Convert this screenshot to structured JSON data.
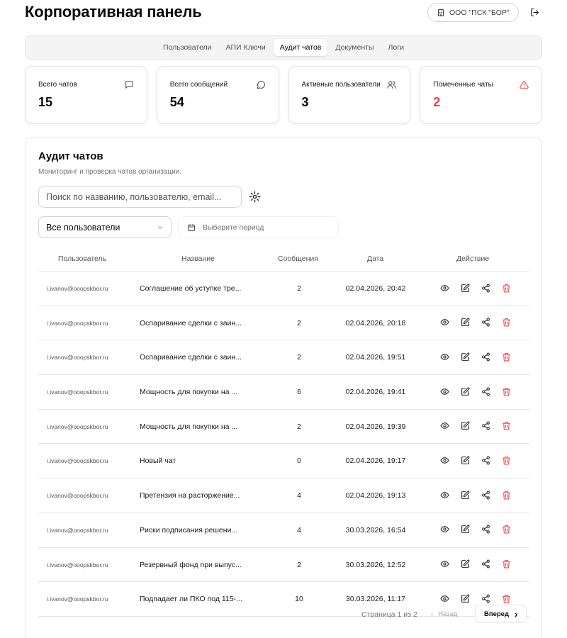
{
  "header": {
    "title": "Корпоративная панель",
    "org_name": "ООО \"ПСК \"БОР\"",
    "icons": {
      "org": "building-icon",
      "logout": "logout-icon"
    }
  },
  "tabs": [
    {
      "label": "Пользователи",
      "active": false
    },
    {
      "label": "АПИ Ключи",
      "active": false
    },
    {
      "label": "Аудит чатов",
      "active": true
    },
    {
      "label": "Документы",
      "active": false
    },
    {
      "label": "Логи",
      "active": false
    }
  ],
  "stats": [
    {
      "label": "Всего чатов",
      "value": "15",
      "icon": "chat-square-icon"
    },
    {
      "label": "Всего сообщений",
      "value": "54",
      "icon": "chat-bubble-icon"
    },
    {
      "label": "Активные пользователи",
      "value": "3",
      "icon": "users-icon"
    },
    {
      "label": "Помеченные чаты",
      "value": "2",
      "icon": "alert-triangle-icon",
      "color": "#ef4444"
    }
  ],
  "audit": {
    "title": "Аудит чатов",
    "subtitle": "Мониторинг и проверка чатов организации.",
    "search_placeholder": "Поиск по названию, пользователю, email...",
    "user_filter": "Все пользователи",
    "period_placeholder": "Выберите период",
    "columns": [
      "Пользователь",
      "Название",
      "Сообщения",
      "Дата",
      "Действие"
    ],
    "rows": [
      {
        "user": "i.ivanov@ooopskbor.ru",
        "name": "Соглашение об уступке тре...",
        "messages": "2",
        "date": "02.04.2026, 20:42"
      },
      {
        "user": "i.ivanov@ooopskbor.ru",
        "name": "Оспаривание сделки с заин...",
        "messages": "2",
        "date": "02.04.2026, 20:18"
      },
      {
        "user": "i.ivanov@ooopskbor.ru",
        "name": "Оспаривание сделки с заин...",
        "messages": "2",
        "date": "02.04.2026, 19:51"
      },
      {
        "user": "i.ivanov@ooopskbor.ru",
        "name": "Мощность для покупки на ...",
        "messages": "6",
        "date": "02.04.2026, 19:41"
      },
      {
        "user": "i.ivanov@ooopskbor.ru",
        "name": "Мощность для покупки на ...",
        "messages": "2",
        "date": "02.04.2026, 19:39"
      },
      {
        "user": "i.ivanov@ooopskbor.ru",
        "name": "Новый чат",
        "messages": "0",
        "date": "02.04.2026, 19:17"
      },
      {
        "user": "i.ivanov@ooopskbor.ru",
        "name": "Претензия на расторжение...",
        "messages": "4",
        "date": "02.04.2026, 19:13"
      },
      {
        "user": "i.ivanov@ooopskbor.ru",
        "name": "Риски подписания решени...",
        "messages": "4",
        "date": "30.03.2026, 16:54"
      },
      {
        "user": "i.ivanov@ooopskbor.ru",
        "name": "Резервный фонд при выпус...",
        "messages": "2",
        "date": "30.03.2026, 12:52"
      },
      {
        "user": "i.ivanov@ooopskbor.ru",
        "name": "Подпадает ли ПКО под 115-...",
        "messages": "10",
        "date": "30.03.2026, 11:17"
      }
    ],
    "action_icons": [
      "eye-icon",
      "edit-icon",
      "share-icon",
      "trash-icon"
    ],
    "action_colors": {
      "trash": "#ef4444"
    }
  },
  "pagination": {
    "info": "Страница 1 из 2",
    "prev_label": "Назад",
    "next_label": "Вперед"
  },
  "colors": {
    "accent_red": "#ef4444",
    "border": "#e4e4e7",
    "muted": "#71717a"
  }
}
